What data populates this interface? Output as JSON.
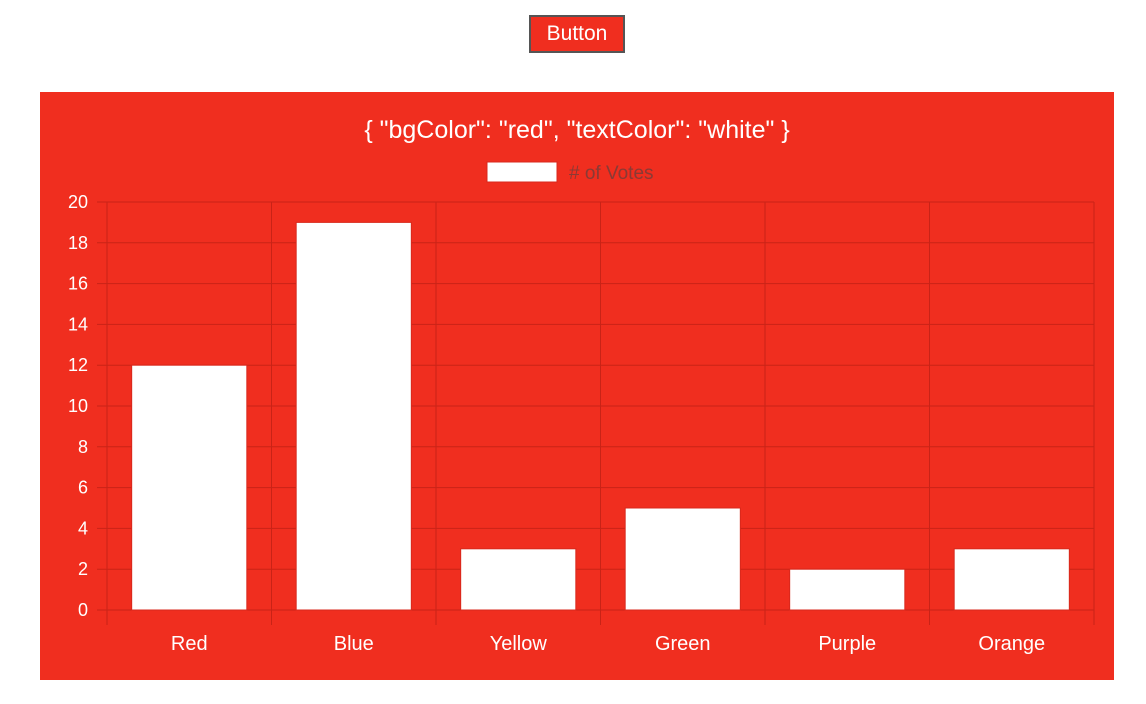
{
  "button": {
    "label": "Button"
  },
  "colors": {
    "panel_bg": "#f02e1f",
    "bar_fill": "#ffffff",
    "bar_border": "#d8281c",
    "grid": "#c92317",
    "text": "#ffffff",
    "legend_text": "#8a3a35"
  },
  "chart_data": {
    "type": "bar",
    "title": "{ \"bgColor\": \"red\", \"textColor\": \"white\" }",
    "categories": [
      "Red",
      "Blue",
      "Yellow",
      "Green",
      "Purple",
      "Orange"
    ],
    "series": [
      {
        "name": "# of Votes",
        "values": [
          12,
          19,
          3,
          5,
          2,
          3
        ]
      }
    ],
    "ylim": [
      0,
      20
    ],
    "yticks": [
      0,
      2,
      4,
      6,
      8,
      10,
      12,
      14,
      16,
      18,
      20
    ],
    "xlabel": "",
    "ylabel": "",
    "grid": true,
    "legend": "top-center"
  }
}
